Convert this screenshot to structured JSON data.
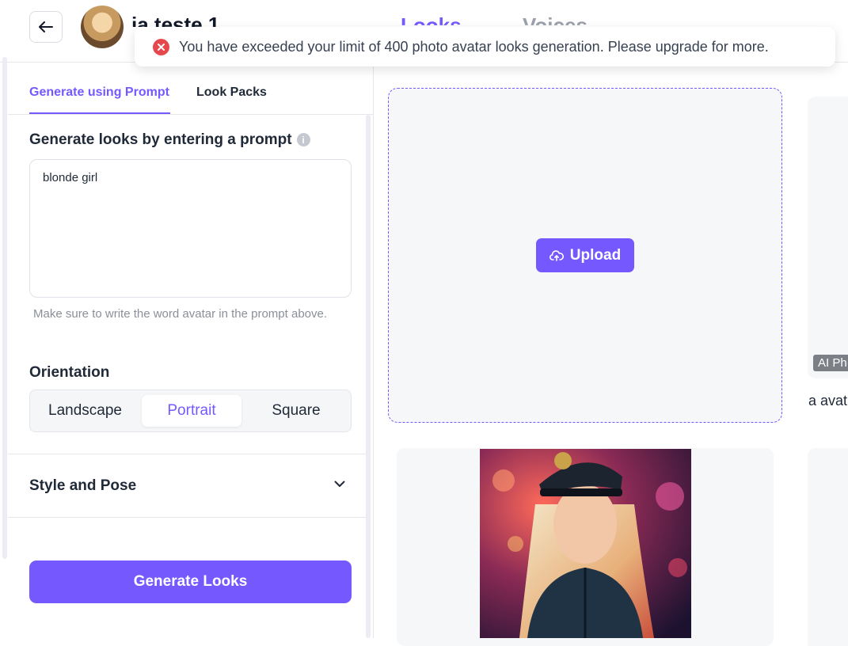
{
  "header": {
    "avatar_name": "ja teste 1",
    "tabs": [
      "Looks",
      "Voices"
    ]
  },
  "toast": {
    "message": "You have exceeded your limit of 400 photo avatar looks generation. Please upgrade for more."
  },
  "left_panel": {
    "tabs": [
      "Generate using Prompt",
      "Look Packs"
    ],
    "prompt_section_title": "Generate looks by entering a prompt",
    "prompt_value": "blonde girl",
    "hint": "Make sure to write the word avatar in the prompt above.",
    "orientation_title": "Orientation",
    "orientation_options": [
      "Landscape",
      "Portrait",
      "Square"
    ],
    "orientation_selected": "Portrait",
    "style_title": "Style and Pose",
    "generate_label": "Generate Looks"
  },
  "main": {
    "upload_label": "Upload",
    "badge_text": "AI Ph",
    "card_caption": "a avat"
  },
  "colors": {
    "accent": "#7559ff",
    "error": "#e5484d"
  }
}
